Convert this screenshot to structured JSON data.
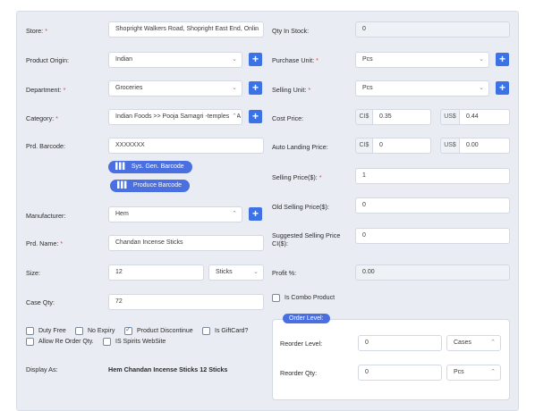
{
  "left": {
    "store": {
      "label": "Store:",
      "value": "Shopright Walkers Road, Shopright East End, Onlin"
    },
    "product_origin": {
      "label": "Product Origin:",
      "value": "Indian"
    },
    "department": {
      "label": "Department:",
      "value": "Groceries"
    },
    "category": {
      "label": "Category:",
      "value": "Indian Foods >> Pooja Samagri -temples & A"
    },
    "barcode": {
      "label": "Prd. Barcode:",
      "value": "XXXXXXX"
    },
    "sys_gen_barcode": "Sys. Gen. Barcode",
    "produce_barcode": "Produce Barcode",
    "manufacturer": {
      "label": "Manufacturer:",
      "value": "Hem"
    },
    "prd_name": {
      "label": "Prd. Name:",
      "value": "Chandan Incense Sticks"
    },
    "size": {
      "label": "Size:",
      "value": "12",
      "unit": "Sticks"
    },
    "case_qty": {
      "label": "Case Qty:",
      "value": "72"
    },
    "checkboxes": {
      "duty_free": "Duty Free",
      "no_expiry": "No Expiry",
      "product_discontinue": "Product Discontinue",
      "is_giftcard": "Is GiftCard?",
      "allow_reorder": "Allow Re Order Qty.",
      "is_spirits": "IS Spirits WebSite"
    },
    "display_as": {
      "label": "Display As:",
      "value": "Hem Chandan Incense Sticks 12 Sticks"
    }
  },
  "right": {
    "qty_in_stock": {
      "label": "Qty In Stock:",
      "value": "0"
    },
    "purchase_unit": {
      "label": "Purchase Unit:",
      "value": "Pcs"
    },
    "selling_unit": {
      "label": "Selling Unit:",
      "value": "Pcs"
    },
    "cost_price": {
      "label": "Cost Price:",
      "ci_prefix": "CI$",
      "ci_value": "0.35",
      "us_prefix": "US$",
      "us_value": "0.44"
    },
    "auto_landing": {
      "label": "Auto Landing Price:",
      "ci_prefix": "CI$",
      "ci_value": "0",
      "us_prefix": "US$",
      "us_value": "0.00"
    },
    "selling_price": {
      "label": "Selling Price($):",
      "value": "1"
    },
    "old_selling_price": {
      "label": "Old Selling Price($):",
      "value": "0"
    },
    "suggested_selling": {
      "label": "Suggested Selling Price CI($):",
      "value": "0"
    },
    "profit": {
      "label": "Profit %:",
      "value": "0.00"
    },
    "is_combo": "Is Combo Product",
    "order_level": {
      "legend": "Order Level:",
      "reorder_level": {
        "label": "Reorder Level:",
        "value": "0",
        "unit": "Cases"
      },
      "reorder_qty": {
        "label": "Reorder Qty:",
        "value": "0",
        "unit": "Pcs"
      }
    }
  },
  "required_mark": "*",
  "plus_label": "+"
}
